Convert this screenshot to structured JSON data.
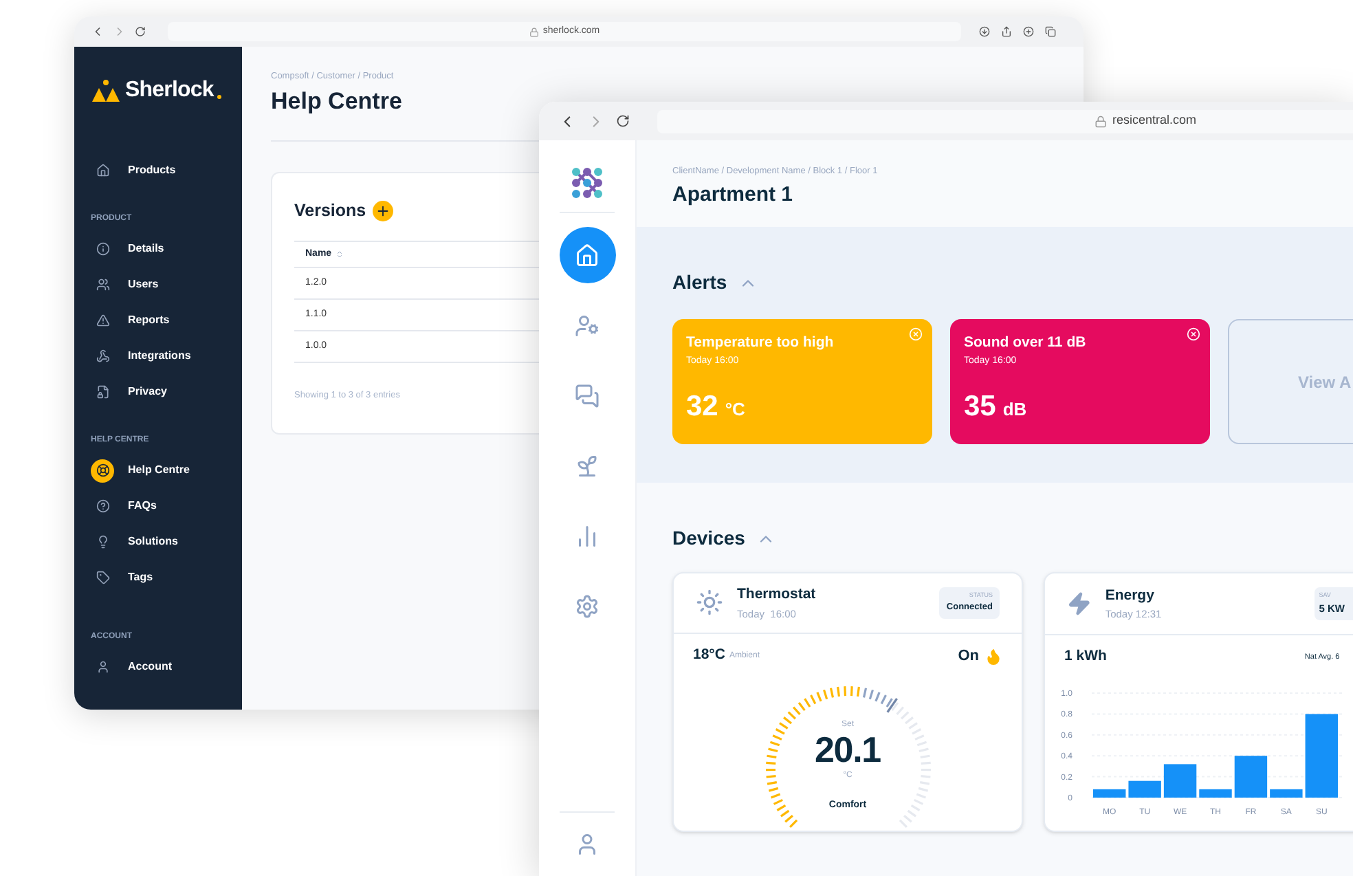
{
  "back_window": {
    "url": "sherlock.com",
    "logo": "Sherlock",
    "nav": [
      {
        "label": "Products",
        "selected": false
      }
    ],
    "sections": [
      {
        "heading": "PRODUCT",
        "items": [
          {
            "label": "Details",
            "selected": false
          },
          {
            "label": "Users",
            "selected": false
          },
          {
            "label": "Reports",
            "selected": false
          },
          {
            "label": "Integrations",
            "selected": false
          },
          {
            "label": "Privacy",
            "selected": false
          }
        ]
      },
      {
        "heading": "HELP CENTRE",
        "items": [
          {
            "label": "Help Centre",
            "selected": true
          },
          {
            "label": "FAQs",
            "selected": false
          },
          {
            "label": "Solutions",
            "selected": false
          },
          {
            "label": "Tags",
            "selected": false
          }
        ]
      },
      {
        "heading": "ACCOUNT",
        "items": [
          {
            "label": "Account",
            "selected": false
          }
        ]
      }
    ],
    "breadcrumb": "Compsoft / Customer / Product",
    "title": "Help Centre",
    "card": {
      "title": "Versions",
      "columns": [
        "Name"
      ],
      "rows": [
        "1.2.0",
        "1.1.0",
        "1.0.0"
      ],
      "footer": "Showing 1 to 3 of 3 entries"
    }
  },
  "front_window": {
    "url": "resicentral.com",
    "nav": [
      {
        "selected": true
      },
      {
        "selected": false
      },
      {
        "selected": false
      },
      {
        "selected": false
      },
      {
        "selected": false
      },
      {
        "selected": false
      }
    ],
    "breadcrumb": "ClientName / Development Name / Block 1 / Floor 1",
    "title": "Apartment 1",
    "alerts": {
      "title": "Alerts",
      "expanded": true,
      "items": [
        {
          "title": "Temperature too high",
          "time": "Today 16:00",
          "value": "32",
          "unit": "°C",
          "color": "#ffb800"
        },
        {
          "title": "Sound over 11 dB",
          "time": "Today 16:00",
          "value": "35",
          "unit": "dB",
          "color": "#e50b5f"
        }
      ],
      "view_all": "View A"
    },
    "devices": {
      "title": "Devices",
      "expanded": true,
      "thermostat": {
        "name": "Thermostat",
        "time": "Today  16:00",
        "status_label": "STATUS",
        "status": "Connected",
        "ambient": "18°C",
        "ambient_label": "Ambient",
        "mode": "On",
        "set_label": "Set",
        "setpoint": "20.1",
        "unit": "°C",
        "preset": "Comfort",
        "level": 0.59
      },
      "energy": {
        "name": "Energy",
        "time": "Today 12:31",
        "badge_label": "SAV",
        "badge_value": "5 KW",
        "reading": "1 kWh",
        "nat_avg": "Nat Avg. 6",
        "chart_data": {
          "type": "bar",
          "categories": [
            "MO",
            "TU",
            "WE",
            "TH",
            "FR",
            "SA",
            "SU"
          ],
          "grid": true,
          "series": [
            {
              "color": "#1591f8",
              "values": [
                0.08,
                0.16,
                0.32,
                0.08,
                0.4,
                0.08,
                0.8
              ]
            }
          ],
          "ylim": [
            0,
            1
          ],
          "yticks": [
            0,
            0.2,
            0.4,
            0.6,
            0.8,
            {
              "value": 1,
              "label": "1.0"
            }
          ]
        }
      }
    }
  }
}
